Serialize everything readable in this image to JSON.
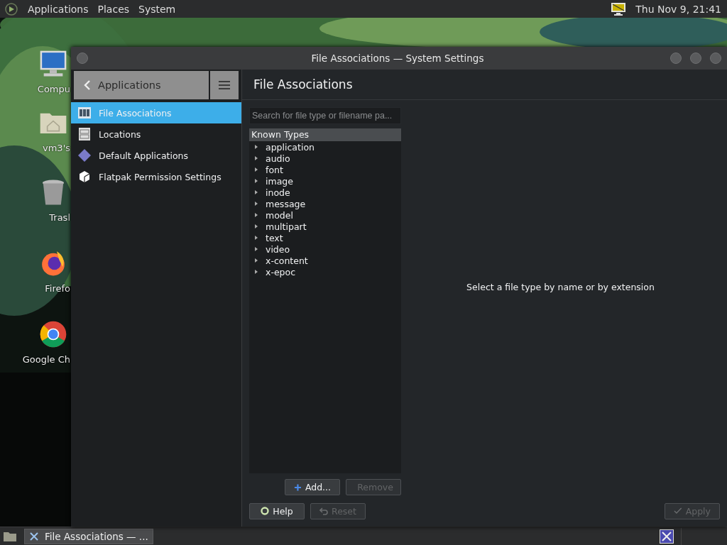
{
  "top_panel": {
    "menus": [
      "Applications",
      "Places",
      "System"
    ],
    "clock": "Thu Nov  9, 21:41"
  },
  "desktop_icons": [
    {
      "label": "Compu",
      "kind": "computer"
    },
    {
      "label": "vm3's",
      "kind": "folder"
    },
    {
      "label": "Trasl",
      "kind": "trash"
    },
    {
      "label": "Firefo",
      "kind": "fox"
    },
    {
      "label": "Google Ch",
      "kind": "wheel"
    }
  ],
  "window": {
    "title": "File Associations — System Settings"
  },
  "sidebar": {
    "back_label": "Applications",
    "items": [
      {
        "label": "File Associations",
        "kind": "assoc",
        "selected": true
      },
      {
        "label": "Locations",
        "kind": "cabinet",
        "selected": false
      },
      {
        "label": "Default Applications",
        "kind": "diamond",
        "selected": false
      },
      {
        "label": "Flatpak Permission Settings",
        "kind": "cube",
        "selected": false
      }
    ]
  },
  "content": {
    "title": "File Associations",
    "search": {
      "placeholder": "Search for file type or filename pa..."
    },
    "tree": {
      "header": "Known Types",
      "items": [
        {
          "label": "application",
          "expanded": false
        },
        {
          "label": "audio",
          "expanded": false
        },
        {
          "label": "font",
          "expanded": false
        },
        {
          "label": "image",
          "expanded": false
        },
        {
          "label": "inode",
          "expanded": false
        },
        {
          "label": "message",
          "expanded": false
        },
        {
          "label": "model",
          "expanded": false
        },
        {
          "label": "multipart",
          "expanded": false
        },
        {
          "label": "text",
          "expanded": false
        },
        {
          "label": "video",
          "expanded": false
        },
        {
          "label": "x-content",
          "expanded": false
        },
        {
          "label": "x-epoc",
          "expanded": false
        }
      ]
    },
    "list_buttons": [
      {
        "label": "Add...",
        "kind": "plus",
        "disabled": false
      },
      {
        "label": "Remove",
        "kind": "minus",
        "disabled": true
      }
    ],
    "hint": "Select a file type by name or by extension"
  },
  "footer_buttons": [
    {
      "label": "Help",
      "kind": "help",
      "disabled": false
    },
    {
      "label": "Reset",
      "kind": "undo",
      "disabled": true
    },
    {
      "label": "Apply",
      "kind": "check",
      "disabled": true
    }
  ],
  "taskbar": {
    "task": "File Associations — ..."
  }
}
